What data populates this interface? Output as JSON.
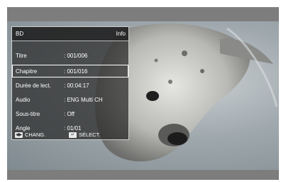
{
  "osd": {
    "title": "BD",
    "info_label": "Info",
    "rows": [
      {
        "label": "Titre",
        "value": ": 001/006",
        "selected": false
      },
      {
        "label": "Chapitre",
        "value": ": 001/016",
        "selected": true
      },
      {
        "label": "Durée de lect.",
        "value": ": 00:04:17",
        "selected": false
      },
      {
        "label": "Audio",
        "value": ": ENG Multi CH",
        "selected": false
      },
      {
        "label": "Sous-titre",
        "value": ": Off",
        "selected": false
      },
      {
        "label": "Angle",
        "value": ": 01/01",
        "selected": false
      }
    ],
    "footer": {
      "change_key_icon": "left-right-arrows-icon",
      "change_label": "CHANG.",
      "select_key_icon": "enter-key-icon",
      "select_label": "SÉLECT."
    }
  }
}
